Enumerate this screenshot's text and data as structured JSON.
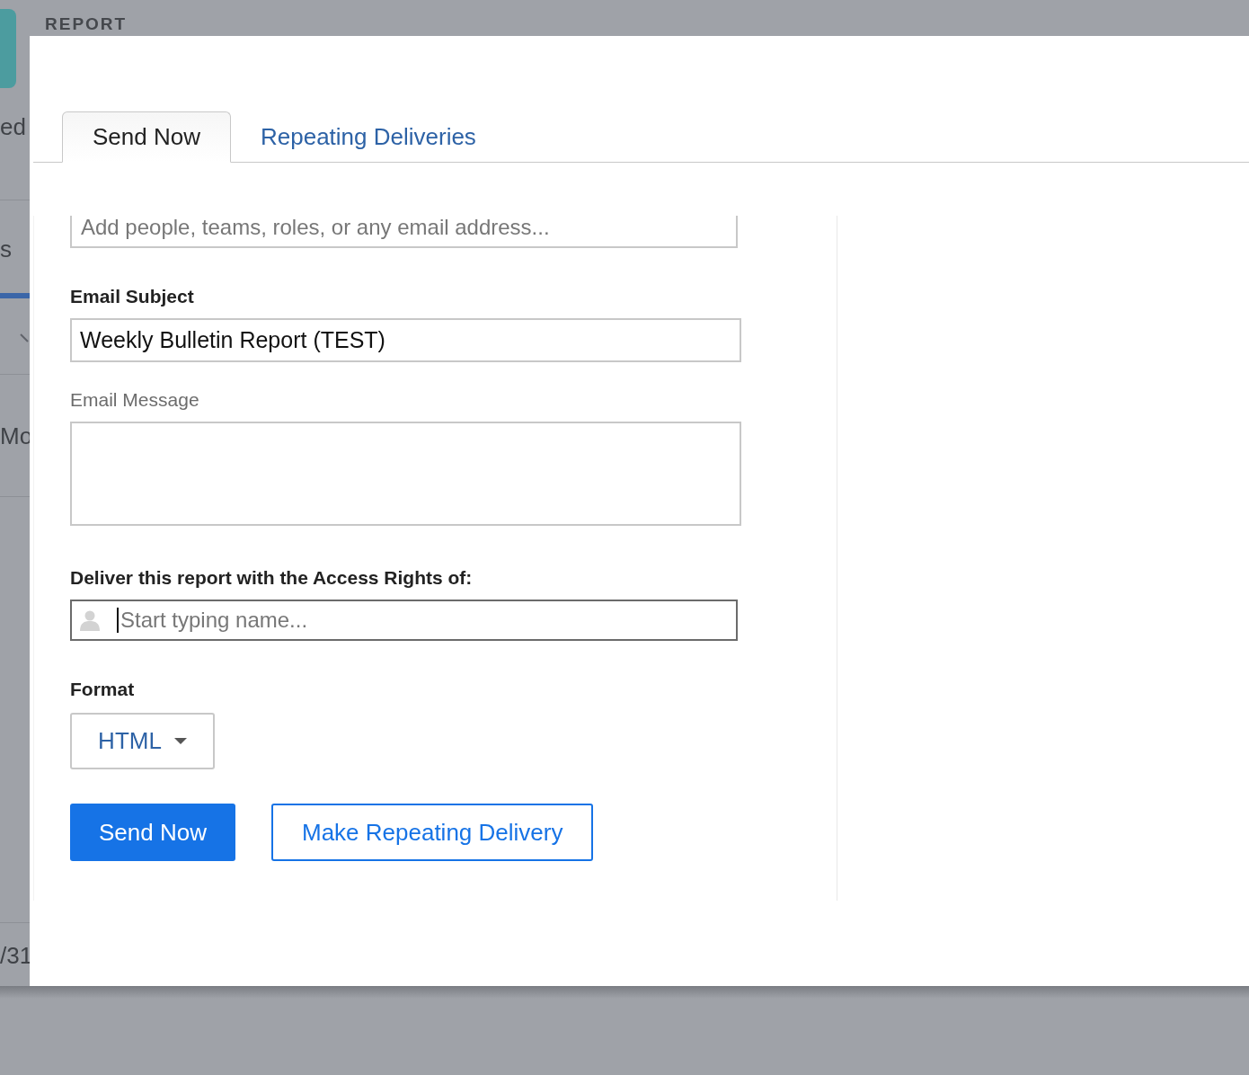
{
  "background": {
    "section_title": "REPORT",
    "fragments": [
      "ed",
      "s",
      "Mo",
      "/31"
    ]
  },
  "tabs": [
    {
      "label": "Send Now",
      "selected": true
    },
    {
      "label": "Repeating Deliveries",
      "selected": false
    }
  ],
  "recipients": {
    "placeholder": "Add people, teams, roles, or any email address..."
  },
  "subject": {
    "label": "Email Subject",
    "value": "Weekly Bulletin Report (TEST)"
  },
  "message": {
    "label": "Email Message"
  },
  "access": {
    "label": "Deliver this report with the Access Rights of:",
    "placeholder": "Start typing name..."
  },
  "format": {
    "label": "Format",
    "value": "HTML"
  },
  "buttons": [
    {
      "label": "Send Now",
      "kind": "primary"
    },
    {
      "label": "Make Repeating Delivery",
      "kind": "secondary"
    }
  ]
}
